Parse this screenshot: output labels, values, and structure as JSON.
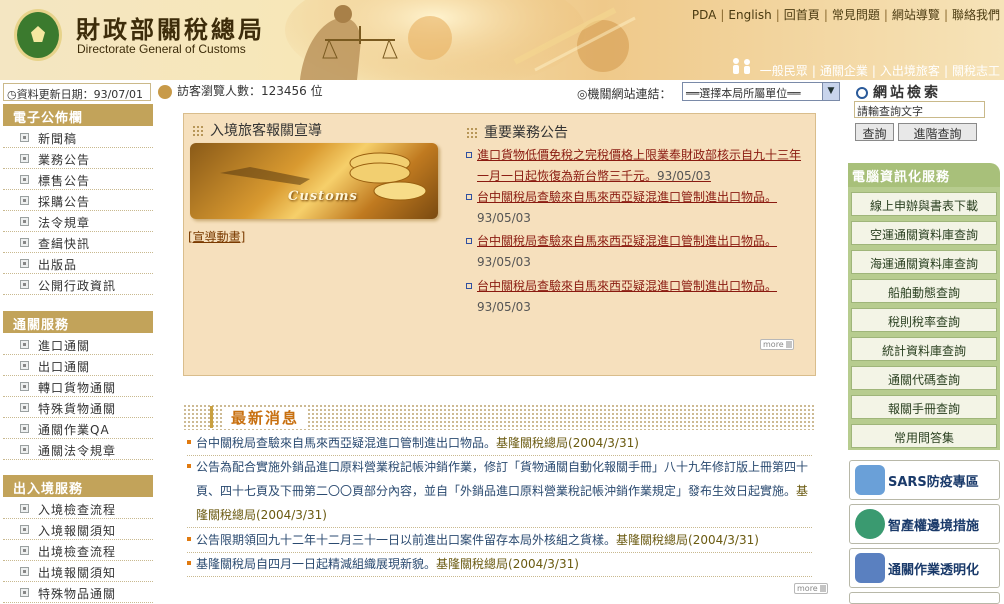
{
  "header": {
    "title": "財政部關稅總局",
    "subtitle": "Directorate General of Customs",
    "top_links": [
      "PDA",
      "English",
      "回首頁",
      "常見問題",
      "網站導覽",
      "聯絡我們"
    ],
    "audience_links": [
      "一般民眾",
      "通關企業",
      "入出境旅客",
      "關稅志工"
    ]
  },
  "status": {
    "update_date": "資料更新日期：93/07/01",
    "visitor_count": "訪客瀏覽人數：123456 位",
    "org_link_label": "◎機關網站連結：",
    "org_select_value": "══選擇本局所屬單位══"
  },
  "left_nav": {
    "sections": [
      {
        "title": "電子公佈欄",
        "items": [
          "新聞稿",
          "業務公告",
          "標售公告",
          "採購公告",
          "法令規章",
          "查緝快訊",
          "出版品",
          "公開行政資訊"
        ]
      },
      {
        "title": "通關服務",
        "items": [
          "進口通關",
          "出口通關",
          "轉口貨物通關",
          "特殊貨物通關",
          "通關作業QA",
          "通關法令規章"
        ]
      },
      {
        "title": "出入境服務",
        "items": [
          "入境檢查流程",
          "入境報關須知",
          "出境檢查流程",
          "出境報關須知",
          "特殊物品通關"
        ]
      }
    ]
  },
  "center": {
    "promo_title": "入境旅客報關宣導",
    "promo_image_text": "Customs",
    "promo_link": "[宣導動畫]",
    "announcements_title": "重要業務公告",
    "announcements": [
      {
        "text": "進口貨物低價免稅之完稅價格上限業奉財政部核示自九十三年一月一日起恢復為新台幣三千元。",
        "date": "93/05/03"
      },
      {
        "text": "台中關稅局查驗來自馬來西亞疑混進口管制進出口物品。",
        "date": "93/05/03"
      },
      {
        "text": "台中關稅局查驗來自馬來西亞疑混進口管制進出口物品。",
        "date": "93/05/03"
      },
      {
        "text": "台中關稅局查驗來自馬來西亞疑混進口管制進出口物品。",
        "date": "93/05/03"
      }
    ],
    "more_label": "more",
    "latest_title": "最新消息",
    "latest": [
      {
        "text": "台中關稅局查驗來自馬來西亞疑混進口管制進出口物品。",
        "source": "基隆關稅總局(2004/3/31)"
      },
      {
        "text": "公告為配合實施外銷品進口原料營業稅記帳沖銷作業，修訂「貨物通關自動化報關手冊」八十九年修訂版上冊第四十頁、四十七頁及下冊第二〇〇頁部分內容，並自「外銷品進口原料營業稅記帳沖銷作業規定」發布生效日起實施。",
        "source": "基隆關稅總局(2004/3/31)"
      },
      {
        "text": "公告限期領回九十二年十二月三十一日以前進出口案件留存本局外核組之貨樣。",
        "source": "基隆關稅總局(2004/3/31)"
      },
      {
        "text": "基隆關稅局自四月一日起精減組織展現新貌。",
        "source": "基隆關稅總局(2004/3/31)"
      }
    ]
  },
  "right": {
    "search_title": "網站檢索",
    "search_value": "請輸查詢文字",
    "search_button": "查詢",
    "advanced_button": "進階查詢",
    "services_title": "電腦資訊化服務",
    "services": [
      "線上申辦與書表下載",
      "空運通關資料庫查詢",
      "海運通關資料庫查詢",
      "船舶動態查詢",
      "稅則稅率查詢",
      "統計資料庫查詢",
      "通關代碼查詢",
      "報關手冊查詢",
      "常用問答集"
    ],
    "promos": [
      {
        "label": "SARS防疫專區",
        "icon": "sars-icon",
        "color": "#6aa0d8"
      },
      {
        "label": "智產權邊境措施",
        "icon": "ip-border-icon",
        "color": "#3a9a70"
      },
      {
        "label": "通關作業透明化",
        "icon": "transparency-icon",
        "color": "#5a80c0"
      }
    ]
  }
}
